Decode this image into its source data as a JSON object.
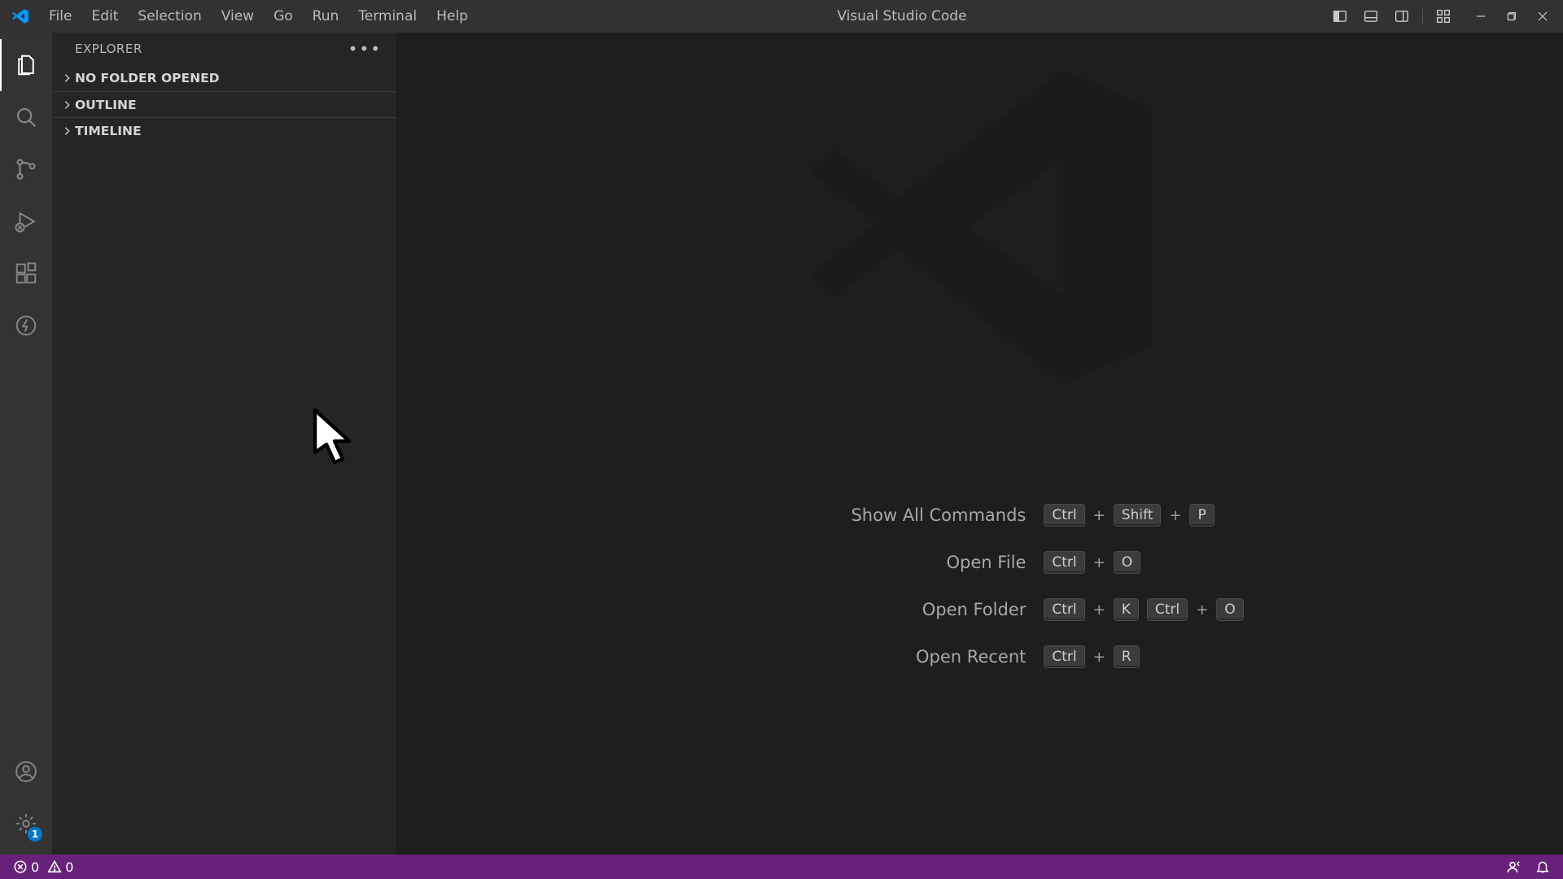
{
  "title": "Visual Studio Code",
  "menu": [
    "File",
    "Edit",
    "Selection",
    "View",
    "Go",
    "Run",
    "Terminal",
    "Help"
  ],
  "sidebar": {
    "header": "EXPLORER",
    "sections": [
      "NO FOLDER OPENED",
      "OUTLINE",
      "TIMELINE"
    ]
  },
  "activity": {
    "items": [
      "explorer",
      "search",
      "source-control",
      "run-debug",
      "extensions",
      "quick"
    ],
    "settings_badge": "1"
  },
  "shortcuts": [
    {
      "label": "Show All Commands",
      "keys": [
        [
          "Ctrl",
          "Shift",
          "P"
        ]
      ]
    },
    {
      "label": "Open File",
      "keys": [
        [
          "Ctrl",
          "O"
        ]
      ]
    },
    {
      "label": "Open Folder",
      "keys": [
        [
          "Ctrl",
          "K"
        ],
        [
          "Ctrl",
          "O"
        ]
      ]
    },
    {
      "label": "Open Recent",
      "keys": [
        [
          "Ctrl",
          "R"
        ]
      ]
    }
  ],
  "status": {
    "errors": "0",
    "warnings": "0"
  },
  "colors": {
    "status_bg": "#68217a",
    "accent": "#0098ff"
  }
}
